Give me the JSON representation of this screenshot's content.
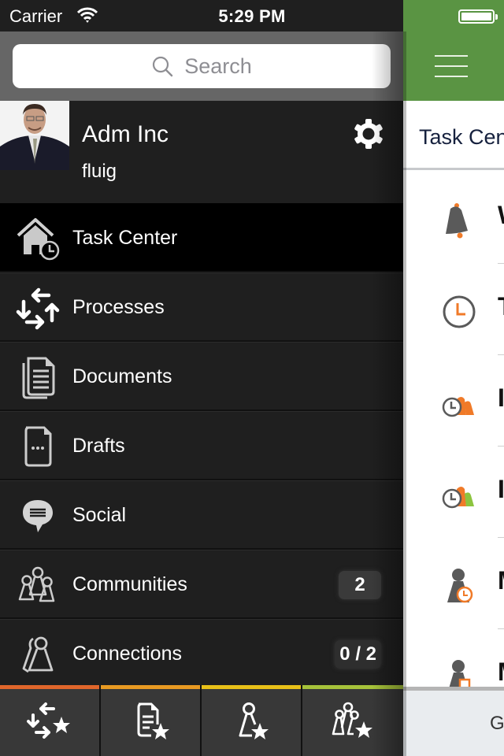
{
  "status_bar": {
    "carrier": "Carrier",
    "time": "5:29 PM",
    "wifi_icon": "wifi-icon",
    "battery_icon": "battery-icon"
  },
  "drawer": {
    "search": {
      "placeholder": "Search",
      "icon": "search-icon"
    },
    "profile": {
      "name": "Adm Inc",
      "org": "fluig",
      "avatar": "user-photo",
      "settings_icon": "gear-icon"
    },
    "menu": [
      {
        "label": "Task Center",
        "icon": "task-center-home-clock-icon",
        "active": true
      },
      {
        "label": "Processes",
        "icon": "processes-arrows-icon"
      },
      {
        "label": "Documents",
        "icon": "documents-icon"
      },
      {
        "label": "Drafts",
        "icon": "drafts-icon"
      },
      {
        "label": "Social",
        "icon": "speech-bubble-icon"
      },
      {
        "label": "Communities",
        "icon": "communities-icon",
        "badge": "2"
      },
      {
        "label": "Connections",
        "icon": "connections-icon",
        "badge": "0 / 2"
      }
    ],
    "tabbar": [
      {
        "name": "favorite-processes",
        "icon": "processes-star-icon",
        "color": "#e0662b"
      },
      {
        "name": "favorite-documents",
        "icon": "document-star-icon",
        "color": "#e89a22"
      },
      {
        "name": "favorite-connections",
        "icon": "person-star-icon",
        "color": "#e8c018"
      },
      {
        "name": "favorite-communities",
        "icon": "group-star-icon",
        "color": "#a6c23a"
      }
    ]
  },
  "main": {
    "navbar": {
      "menu_icon": "hamburger-icon",
      "color": "#5a9443"
    },
    "header_title": "Task Center",
    "tasks": [
      {
        "icon": "bell-icon",
        "text": "W"
      },
      {
        "icon": "clock-icon",
        "text": "T"
      },
      {
        "icon": "clock-group-orange-icon",
        "text": "I"
      },
      {
        "icon": "clock-group-green-icon",
        "text": "I"
      },
      {
        "icon": "person-clock-icon",
        "text": "M"
      },
      {
        "icon": "person-document-icon",
        "text": "M"
      }
    ],
    "bottom_bar_text": "G"
  },
  "colors": {
    "accent_green": "#5a9443",
    "accent_orange": "#f07a28",
    "drawer_bg": "#1f1f1f",
    "active_bg": "#000000"
  }
}
